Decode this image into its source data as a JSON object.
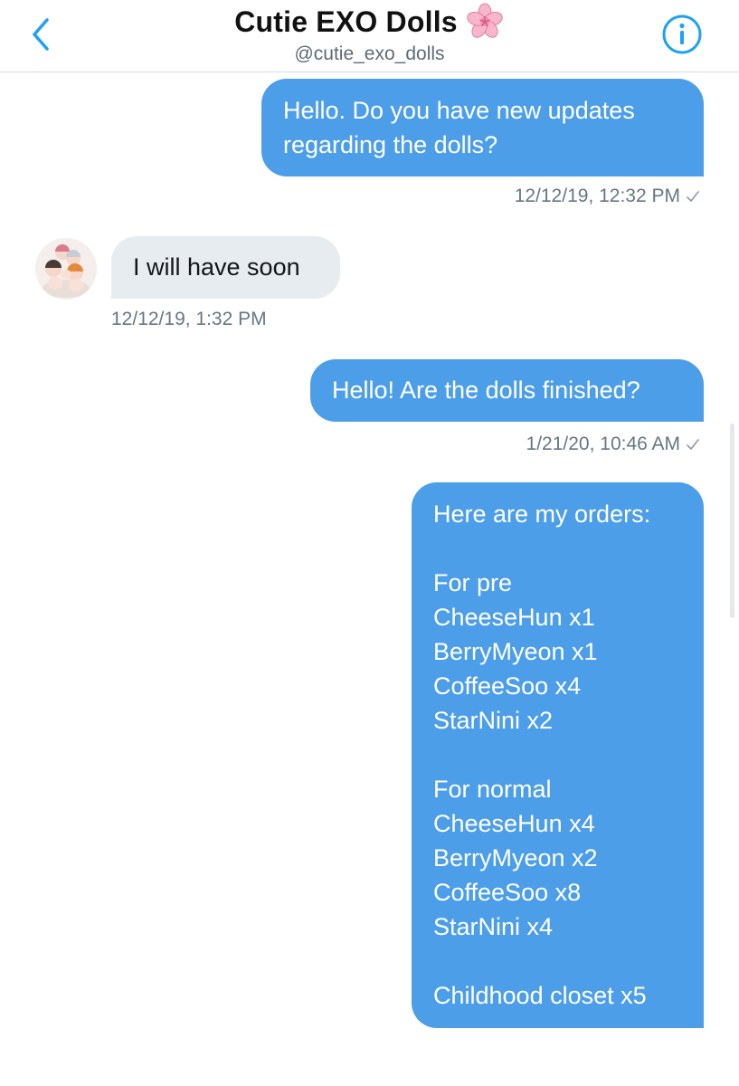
{
  "header": {
    "title": "Cutie EXO Dolls",
    "title_emoji": "cherry-blossom-icon",
    "handle": "@cutie_exo_dolls",
    "back_icon": "chevron-left-icon",
    "info_icon": "info-icon"
  },
  "colors": {
    "accent": "#4d9ee9",
    "incoming_bubble": "#e6ecf0",
    "timestamp": "#657786"
  },
  "messages": [
    {
      "direction": "outgoing",
      "text": "Hello. Do you have new updates\nregarding the dolls?",
      "timestamp": "12/12/19, 12:32 PM",
      "status_icon": "check-icon"
    },
    {
      "direction": "incoming",
      "text": "I will have soon",
      "timestamp": "12/12/19, 1:32 PM",
      "avatar": "avatar-dolls-image"
    },
    {
      "direction": "outgoing",
      "text": "Hello! Are the dolls finished?",
      "timestamp": "1/21/20, 10:46 AM",
      "status_icon": "check-icon"
    },
    {
      "direction": "outgoing",
      "text": "Here are my orders:\n\nFor pre\nCheeseHun x1\nBerryMyeon x1\nCoffeeSoo x4\nStarNini x2\n\nFor normal\nCheeseHun x4\nBerryMyeon x2\nCoffeeSoo x8\nStarNini x4\n\nChildhood closet x5"
    }
  ]
}
